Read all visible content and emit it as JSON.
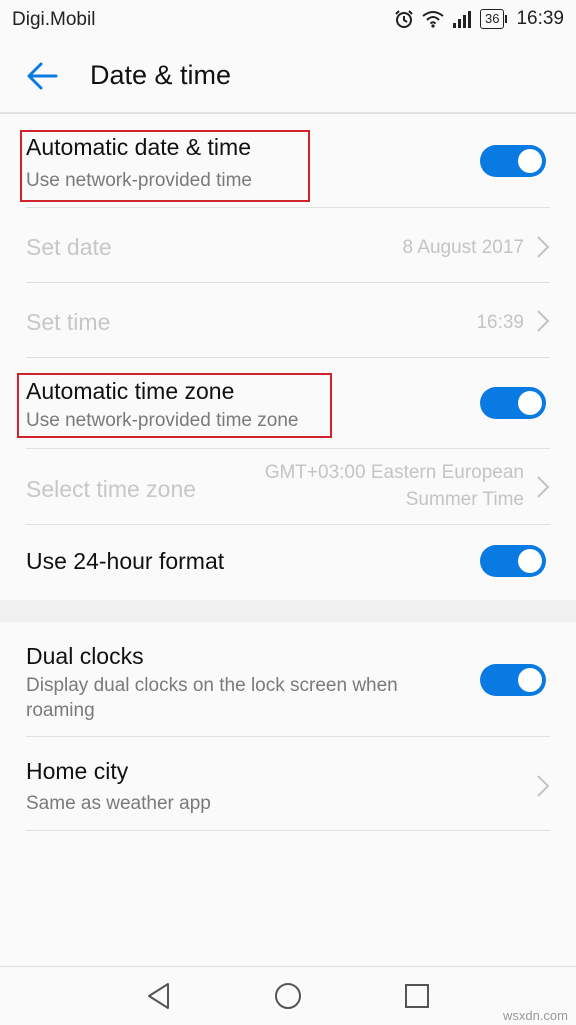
{
  "status_bar": {
    "carrier": "Digi.Mobil",
    "battery": "36",
    "time": "16:39",
    "icons": [
      "alarm-icon",
      "wifi-icon",
      "signal-icon",
      "battery-icon"
    ]
  },
  "header": {
    "title": "Date & time",
    "back_icon": "arrow-left-icon",
    "accent_color": "#0a7ae3"
  },
  "settings": {
    "auto_datetime": {
      "title": "Automatic date & time",
      "subtitle": "Use network-provided time",
      "enabled": true
    },
    "set_date": {
      "title": "Set date",
      "value": "8 August 2017"
    },
    "set_time": {
      "title": "Set time",
      "value": "16:39"
    },
    "auto_timezone": {
      "title": "Automatic time zone",
      "subtitle": "Use network-provided time zone",
      "enabled": true
    },
    "select_timezone": {
      "title": "Select time zone",
      "value_line1": "GMT+03:00 Eastern European",
      "value_line2": "Summer Time"
    },
    "format_24h": {
      "title": "Use 24-hour format",
      "enabled": true
    },
    "dual_clocks": {
      "title": "Dual clocks",
      "subtitle_line1": "Display dual clocks on the lock screen when",
      "subtitle_line2": "roaming",
      "enabled": true
    },
    "home_city": {
      "title": "Home city",
      "subtitle": "Same as weather app"
    }
  },
  "nav_bar": {
    "back": "triangle-back-icon",
    "home": "circle-home-icon",
    "recents": "square-recents-icon"
  },
  "watermark": "wsxdn.com",
  "highlight_color": "#d2222b"
}
